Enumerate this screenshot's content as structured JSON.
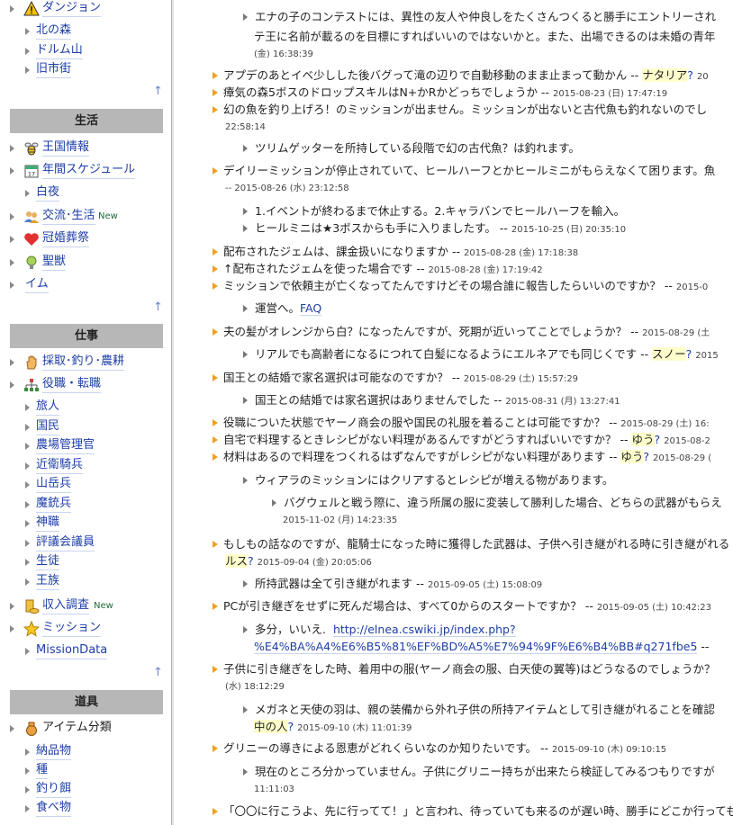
{
  "sidebar": {
    "top_items": [
      {
        "label": "ダンジョン",
        "icon": "warning-icon"
      },
      {
        "label": "北の森"
      },
      {
        "label": "ドルム山"
      },
      {
        "label": "旧市街"
      }
    ],
    "up_arrow": "↑",
    "sections": [
      {
        "title": "生活",
        "items": [
          {
            "label": "王国情報",
            "icon": "bee-icon"
          },
          {
            "label": "年間スケジュール",
            "icon": "calendar-icon"
          },
          {
            "label": "白夜"
          },
          {
            "label": "交流･生活",
            "icon": "people-icon",
            "badge": "New"
          },
          {
            "label": "冠婚葬祭",
            "icon": "heart-icon"
          },
          {
            "label": "聖獣",
            "icon": "lightbulb-icon"
          },
          {
            "label": "イム"
          }
        ]
      },
      {
        "title": "仕事",
        "items": [
          {
            "label": "採取･釣り･農耕",
            "icon": "hand-icon"
          },
          {
            "label": "役職・転職",
            "icon": "org-chart-icon"
          },
          {
            "label": "旅人"
          },
          {
            "label": "国民"
          },
          {
            "label": "農場管理官"
          },
          {
            "label": "近衛騎兵"
          },
          {
            "label": "山岳兵"
          },
          {
            "label": "魔銃兵"
          },
          {
            "label": "神職"
          },
          {
            "label": "評議会議員"
          },
          {
            "label": "生徒"
          },
          {
            "label": "王族"
          },
          {
            "label": "収入調査",
            "icon": "coins-icon",
            "badge": "New"
          },
          {
            "label": "ミッション",
            "icon": "star-icon"
          },
          {
            "label": "MissionData"
          }
        ]
      },
      {
        "title": "道具",
        "items": [
          {
            "label": "アイテム分類",
            "icon": "bag-icon"
          },
          {
            "label": "納品物"
          },
          {
            "label": "種"
          },
          {
            "label": "釣り餌"
          },
          {
            "label": "食べ物"
          }
        ]
      }
    ]
  },
  "content": {
    "l1": "エナの子のコンテストには、異性の友人や仲良しをたくさんつくると勝手にエントリーされ",
    "l2": "テ王に名前が載るのを目標にすればいいのではないかと。また、出場できるのは未婚の青年",
    "l3": "(金) 16:38:39",
    "l4a": "アプデのあとイベ少しした後バグって滝の辺りで自動移動のまま止まって動かん --",
    "l4n": "ナタリア",
    "l4q": "?",
    "l4d": "20",
    "l5a": "瘴気の森5ボスのドロップスキルはN+かRかどっちでしょうか --",
    "l5d": "2015-08-23 (日) 17:47:19",
    "l6": "幻の魚を釣り上げろ！のミッションが出ません。ミッションが出ないと古代魚も釣れないのでし",
    "l7": "22:58:14",
    "l8": "ツリムゲッターを所持している段階で幻の古代魚？は釣れます。",
    "l9": "デイリーミッションが停止されていて、ヒールハーフとかヒールミニがもらえなくて困ります。魚",
    "l10": "-- 2015-08-26 (水) 23:12:58",
    "l11": "1.イベントが終わるまで休止する。2.キャラバンでヒールハーフを輸入。",
    "l12a": "ヒールミニは★3ボスからも手に入りましたす。 --",
    "l12d": "2015-10-25 (日) 20:35:10",
    "l13a": "配布されたジェムは、課金扱いになりますか --",
    "l13d": "2015-08-28 (金) 17:18:38",
    "l14a": "↑配布されたジェムを使った場合です --",
    "l14d": "2015-08-28 (金) 17:19:42",
    "l15a": "ミッションで依頼主が亡くなってたんですけどその場合誰に報告したらいいのですか？ --",
    "l15d": "2015-0",
    "l16a": "運営へ。",
    "l16l": "FAQ",
    "l17a": "夫の髪がオレンジから白？になったんですが、死期が近いってことでしょうか？ --",
    "l17d": "2015-08-29 (土",
    "l18a": "リアルでも高齢者になるにつれて白髪になるようにエルネアでも同じくです --",
    "l18n": "スノー",
    "l18q": "?",
    "l18d": "2015",
    "l19a": "国王との結婚で家名選択は可能なのですか？ --",
    "l19d": "2015-08-29 (土) 15:57:29",
    "l20a": "国王との結婚では家名選択はありませんでした --",
    "l20d": "2015-08-31 (月) 13:27:41",
    "l21a": "役職についた状態でヤーノ商会の服や国民の礼服を着ることは可能ですか？ --",
    "l21d": "2015-08-29 (土) 16:",
    "l22a": "自宅で料理するときレシピがない料理があるんですがどうすればいいですか？ --",
    "l22n": "ゆう",
    "l22q": "?",
    "l22d": "2015-08-2",
    "l23a": "材料はあるので料理をつくれるはずなんですがレシピがない料理があります --",
    "l23n": "ゆう",
    "l23q": "?",
    "l23d": "2015-08-29 (",
    "l24": "ウィアラのミッションにはクリアするとレシピが増える物があります。",
    "l25": "バグウェルと戦う際に、違う所属の服に変装して勝利した場合、どちらの武器がもらえ",
    "l26": "2015-11-02 (月) 14:23:35",
    "l27": "もしもの話なのですが、龍騎士になった時に獲得した武器は、子供へ引き継がれる時に引き継がれる",
    "l28n": "ルス",
    "l28q": "?",
    "l28d": "2015-09-04 (金) 20:05:06",
    "l29a": "所持武器は全て引き継がれます --",
    "l29d": "2015-09-05 (土) 15:08:09",
    "l30a": "PCが引き継ぎをせずに死んだ場合は、すべて0からのスタートですか？ --",
    "l30d": "2015-09-05 (土) 10:42:23",
    "l31a": "多分，いいえ.",
    "l31l": "http://elnea.cswiki.jp/index.php?",
    "l32l": "%E4%BA%A4%E6%B5%81%EF%BD%A5%E7%94%9F%E6%B4%BB#q271fbe5",
    "l32b": "--",
    "l33": "子供に引き継ぎをした時、着用中の服(ヤーノ商会の服、白天使の翼等)はどうなるのでしょうか？",
    "l34": "(水) 18:12:29",
    "l35": "メガネと天使の羽は、親の装備から外れ子供の所持アイテムとして引き継がれることを確認",
    "l36n": "中の人",
    "l36q": "?",
    "l36d": "2015-09-10 (木) 11:01:39",
    "l37a": "グリニーの導きによる恩恵がどれくらいなのか知りたいです。 --",
    "l37d": "2015-09-10 (木) 09:10:15",
    "l38": "現在のところ分かっていません。子供にグリニー持ちが出来たら検証してみるつもりですが",
    "l39": "11:11:03",
    "l40": "「〇〇に行こうよ、先に行ってて！」と言われ、待っていても来るのが遅い時、勝手にどこか行っても"
  }
}
